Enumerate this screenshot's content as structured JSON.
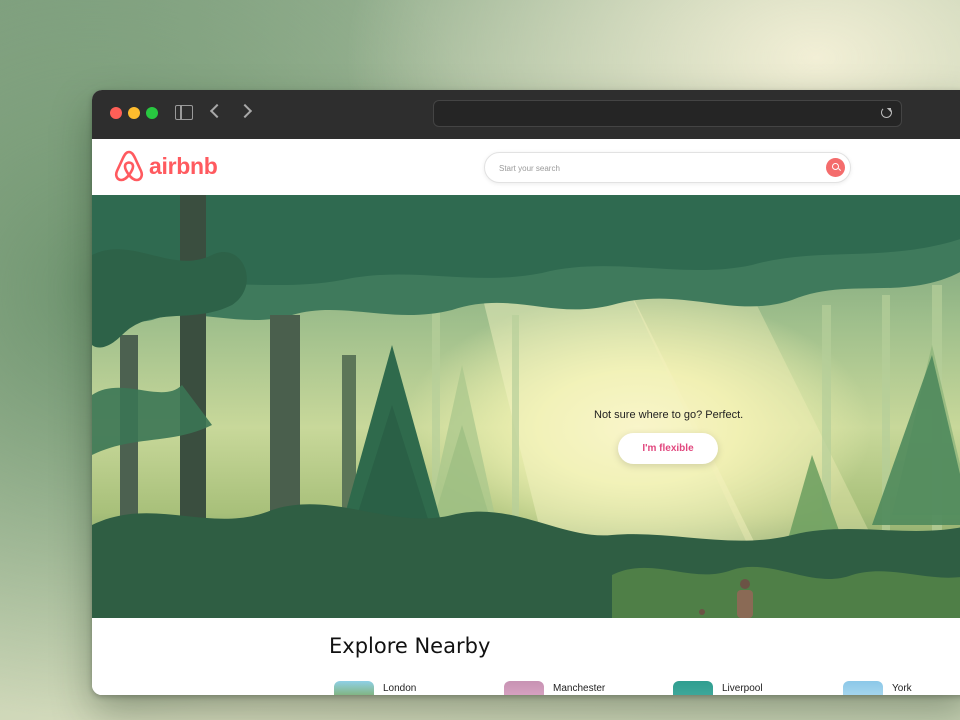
{
  "browser": {
    "traffic_lights": [
      "close",
      "minimize",
      "maximize"
    ],
    "icons": [
      "sidebar-icon",
      "back-icon",
      "forward-icon",
      "reload-icon"
    ]
  },
  "brand": {
    "name": "airbnb",
    "color": "#ff5a5f"
  },
  "search": {
    "placeholder": "Start your search",
    "button_color": "#f46c6c"
  },
  "hero": {
    "headline": "Not sure where to go? Perfect.",
    "button_label": "I'm flexible",
    "button_text_color": "#e1477e"
  },
  "explore": {
    "title": "Explore Nearby",
    "items": [
      {
        "label": "London",
        "thumb_color": "#7fb070"
      },
      {
        "label": "Manchester",
        "thumb_color": "#c792b3"
      },
      {
        "label": "Liverpool",
        "thumb_color": "#3fa89a"
      },
      {
        "label": "York",
        "thumb_color": "#8cc8e8"
      }
    ]
  }
}
